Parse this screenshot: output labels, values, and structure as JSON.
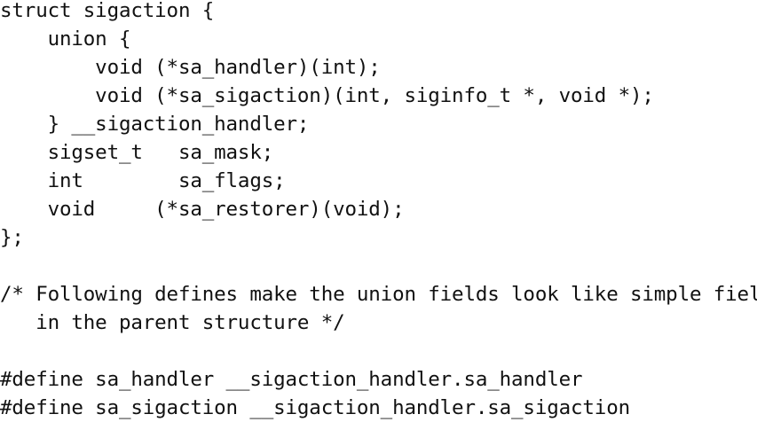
{
  "code": {
    "lines": [
      "struct sigaction {",
      "    union {",
      "        void (*sa_handler)(int);",
      "        void (*sa_sigaction)(int, siginfo_t *, void *);",
      "    } __sigaction_handler;",
      "    sigset_t   sa_mask;",
      "    int        sa_flags;",
      "    void     (*sa_restorer)(void);",
      "};",
      "",
      "/* Following defines make the union fields look like simple fields",
      "   in the parent structure */",
      "",
      "#define sa_handler __sigaction_handler.sa_handler",
      "#define sa_sigaction __sigaction_handler.sa_sigaction"
    ]
  }
}
